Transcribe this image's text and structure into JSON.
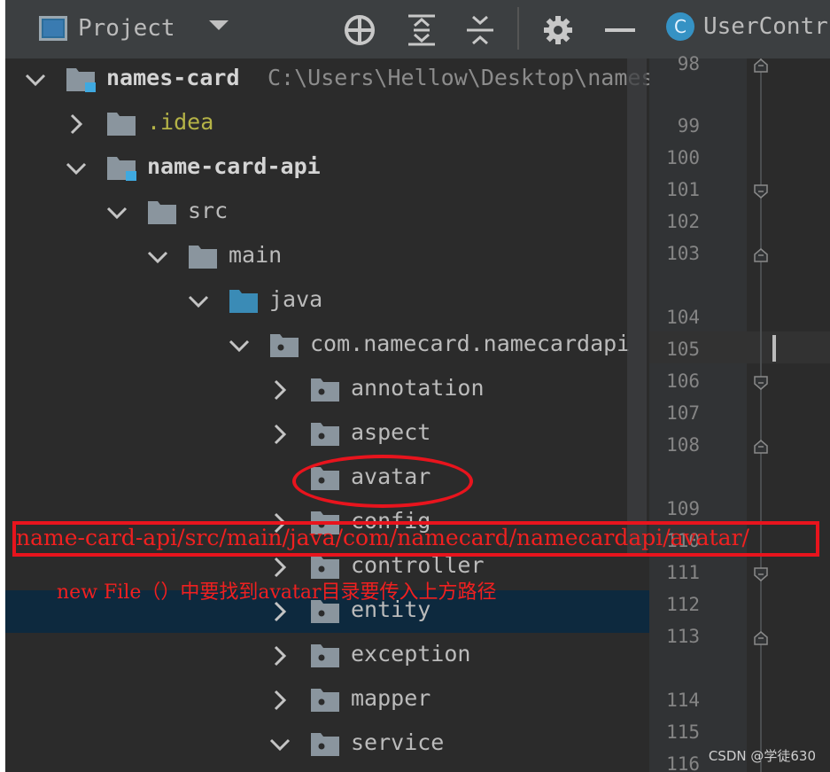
{
  "toolbar": {
    "project_label": "Project",
    "tab_icon_letter": "C",
    "tab_label": "UserContr",
    "icons": [
      "project-view-icon",
      "dropdown-icon",
      "locate-icon",
      "expand-all-icon",
      "collapse-all-icon",
      "gear-icon",
      "minimize-icon"
    ]
  },
  "tree": [
    {
      "label": "names-card",
      "path": "C:\\Users\\Hellow\\Desktop\\names",
      "arrow": "down",
      "icon": "module",
      "style": "bold",
      "indent": 0
    },
    {
      "label": ".idea",
      "arrow": "right",
      "icon": "folder",
      "style": "idea",
      "indent": 1
    },
    {
      "label": "name-card-api",
      "arrow": "down",
      "icon": "module",
      "style": "bold",
      "indent": 1
    },
    {
      "label": "src",
      "arrow": "down",
      "icon": "folder",
      "indent": 2
    },
    {
      "label": "main",
      "arrow": "down",
      "icon": "folder",
      "indent": 3
    },
    {
      "label": "java",
      "arrow": "down",
      "icon": "source",
      "indent": 4
    },
    {
      "label": "com.namecard.namecardapi",
      "arrow": "down",
      "icon": "package",
      "indent": 5
    },
    {
      "label": "annotation",
      "arrow": "right",
      "icon": "package",
      "indent": 6
    },
    {
      "label": "aspect",
      "arrow": "right",
      "icon": "package",
      "indent": 6
    },
    {
      "label": "avatar",
      "arrow": "none",
      "icon": "package",
      "indent": 6
    },
    {
      "label": "config",
      "arrow": "right",
      "icon": "package",
      "indent": 6
    },
    {
      "label": "controller",
      "arrow": "right",
      "icon": "package",
      "indent": 6
    },
    {
      "label": "entity",
      "arrow": "right",
      "icon": "package",
      "indent": 6,
      "selected": true
    },
    {
      "label": "exception",
      "arrow": "right",
      "icon": "package",
      "indent": 6
    },
    {
      "label": "mapper",
      "arrow": "right",
      "icon": "package",
      "indent": 6
    },
    {
      "label": "service",
      "arrow": "down",
      "icon": "package",
      "indent": 6
    }
  ],
  "gutter": {
    "lines": [
      {
        "n": "98",
        "fold": "end"
      },
      {
        "n": "99"
      },
      {
        "n": "100"
      },
      {
        "n": "101",
        "fold": "start"
      },
      {
        "n": "102"
      },
      {
        "n": "103",
        "fold": "end"
      },
      {
        "n": "104"
      },
      {
        "n": "105",
        "current": true
      },
      {
        "n": "106",
        "fold": "start"
      },
      {
        "n": "107"
      },
      {
        "n": "108",
        "fold": "end"
      },
      {
        "n": "109"
      },
      {
        "n": "110"
      },
      {
        "n": "111",
        "fold": "start"
      },
      {
        "n": "112"
      },
      {
        "n": "113",
        "fold": "end"
      },
      {
        "n": "114"
      },
      {
        "n": "115"
      },
      {
        "n": "116"
      }
    ]
  },
  "annotation": {
    "path_text": "name-card-api/src/main/java/com/namecard/namecardapi/avatar/",
    "note_text": "new File（）中要找到avatar目录要传入上方路径",
    "color": "#e8141d"
  },
  "watermark": "CSDN @学徒630",
  "colors": {
    "background": "#2b2b2b",
    "toolbar": "#3c3f41",
    "selection": "#0d293e",
    "folder": "#8a959e",
    "source_folder": "#3a8bb6",
    "module_badge": "#3fa9e0"
  }
}
